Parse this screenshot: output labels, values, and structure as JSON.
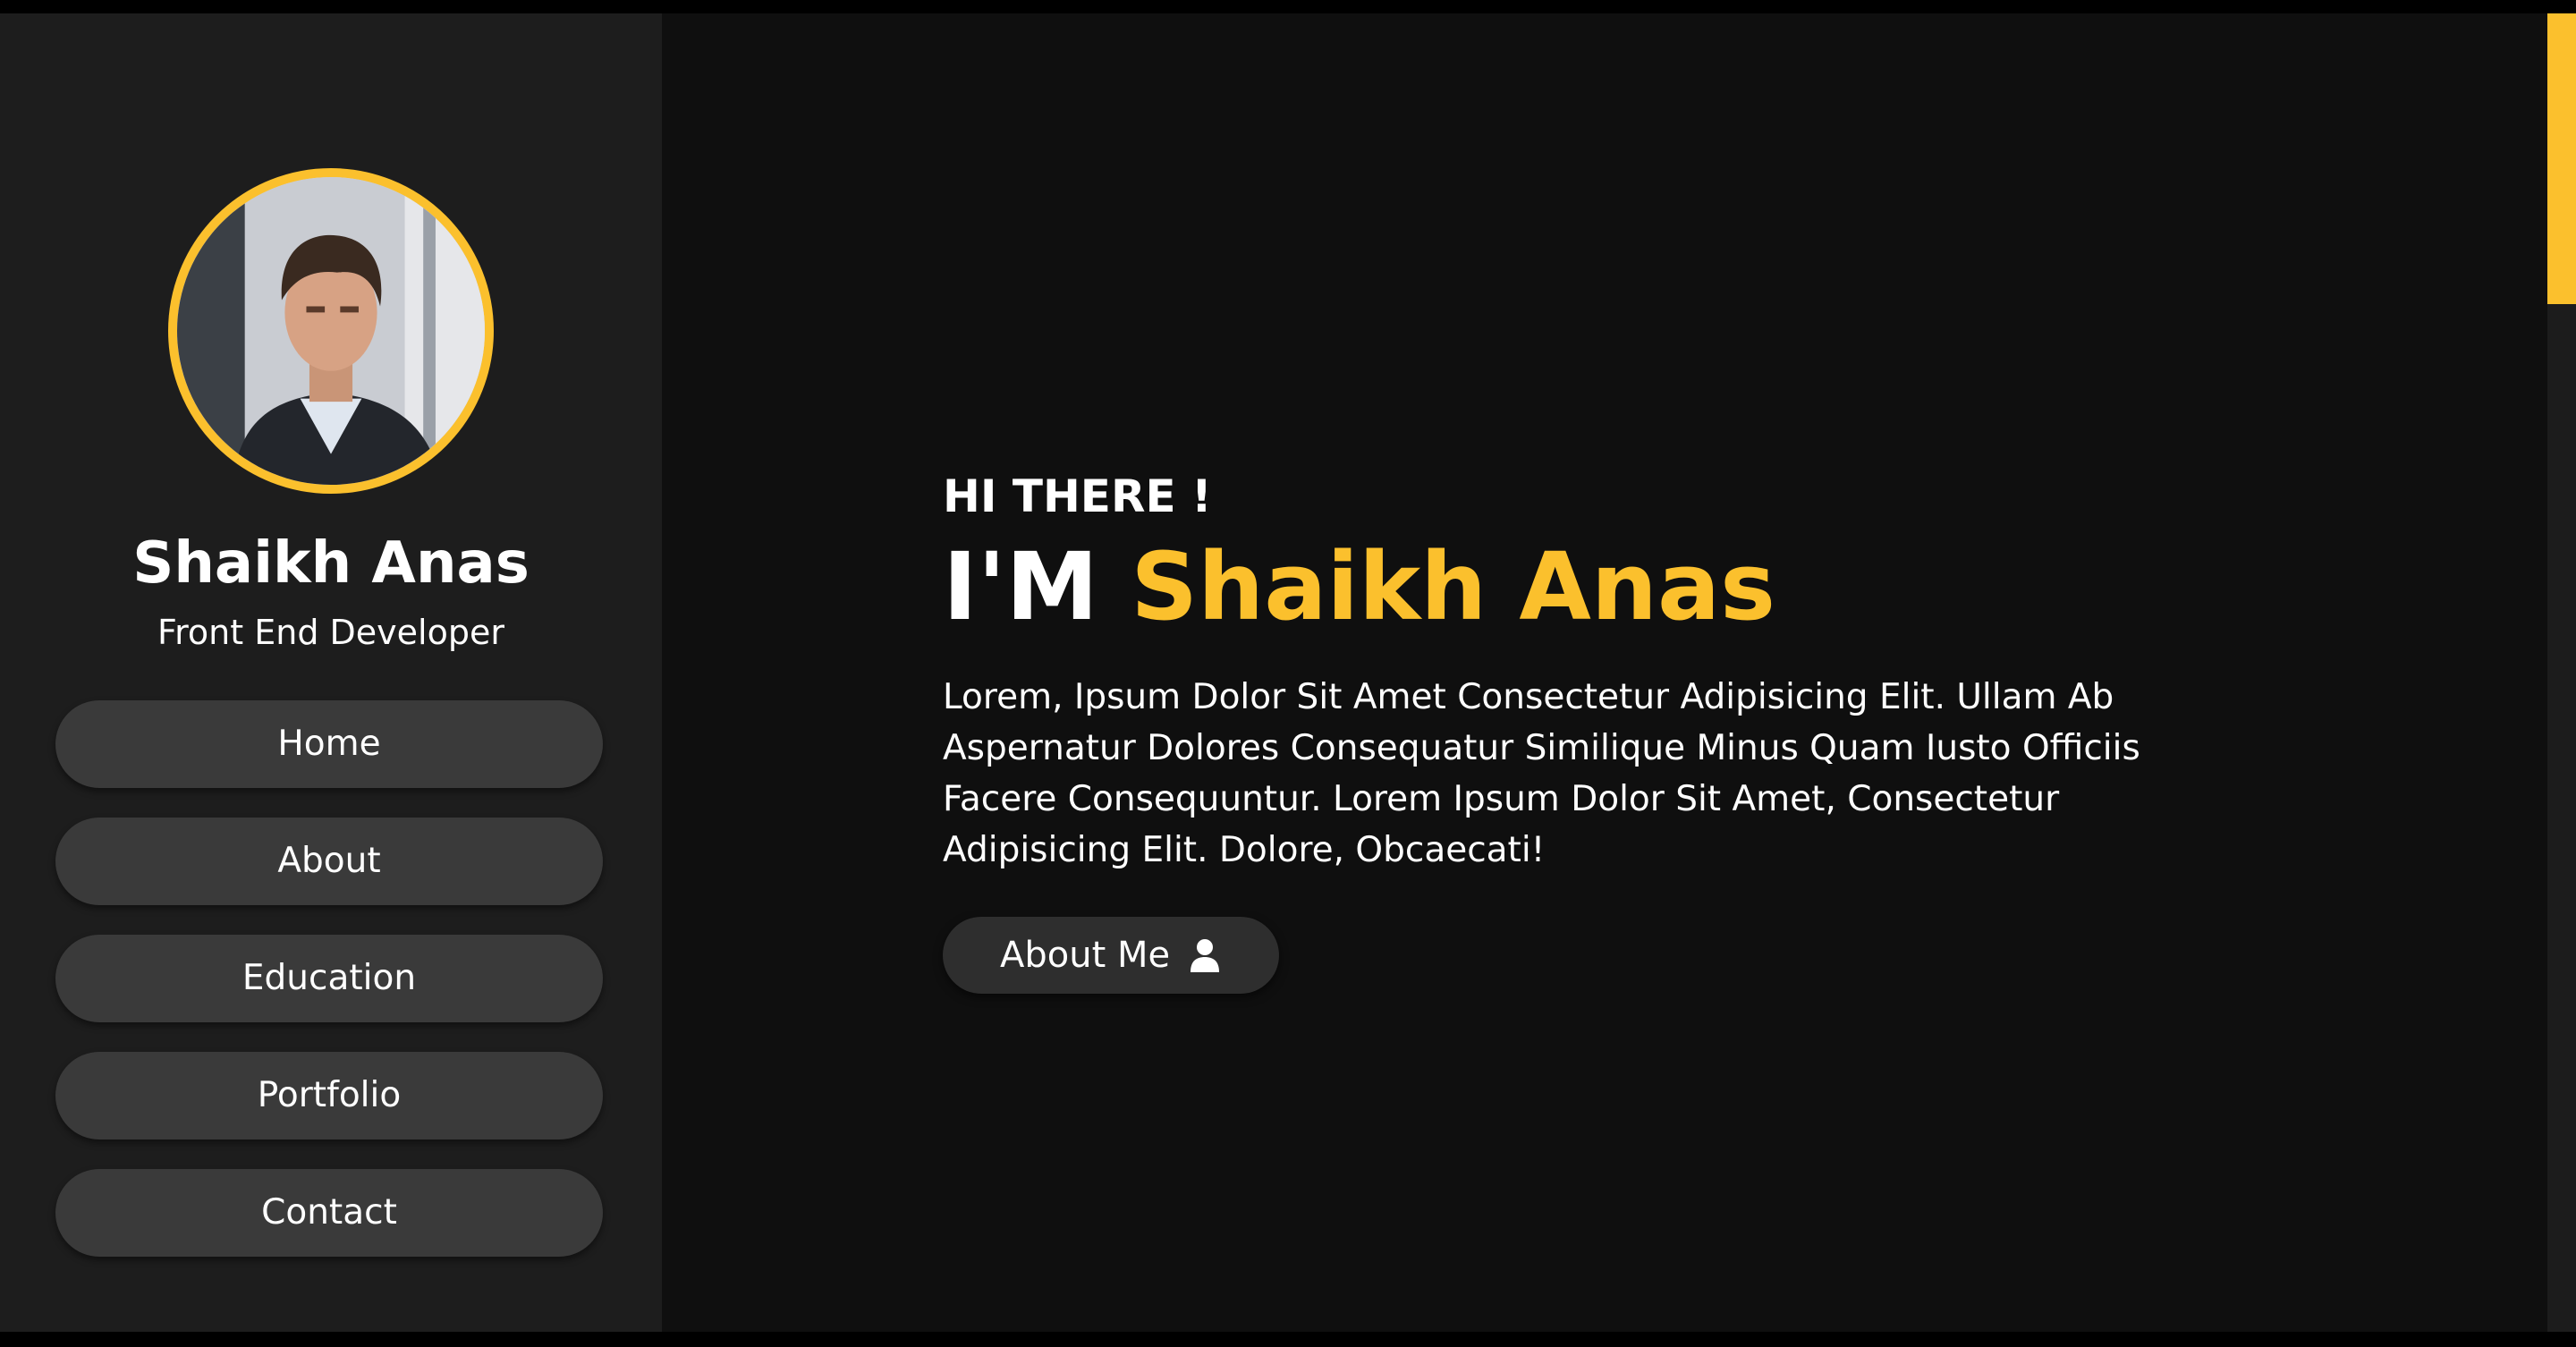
{
  "theme": {
    "accent": "#fbc02d",
    "sidebar_bg": "#1d1d1d",
    "main_bg": "#0f0f0f",
    "button_bg": "#3a3a3a"
  },
  "sidebar": {
    "avatar_icon": "profile-photo",
    "name": "Shaikh Anas",
    "role": "Front End Developer",
    "nav": [
      {
        "label": "Home"
      },
      {
        "label": "About"
      },
      {
        "label": "Education"
      },
      {
        "label": "Portfolio"
      },
      {
        "label": "Contact"
      }
    ]
  },
  "hero": {
    "greeting": "HI THERE !",
    "headline_prefix": "I'M",
    "headline_name": "Shaikh Anas",
    "intro": "Lorem, Ipsum Dolor Sit Amet Consectetur Adipisicing Elit. Ullam Ab Aspernatur Dolores Consequatur Similique Minus Quam Iusto Officiis Facere Consequuntur. Lorem Ipsum Dolor Sit Amet, Consectetur Adipisicing Elit. Dolore, Obcaecati!",
    "button_label": "About Me",
    "button_icon": "user-icon"
  }
}
